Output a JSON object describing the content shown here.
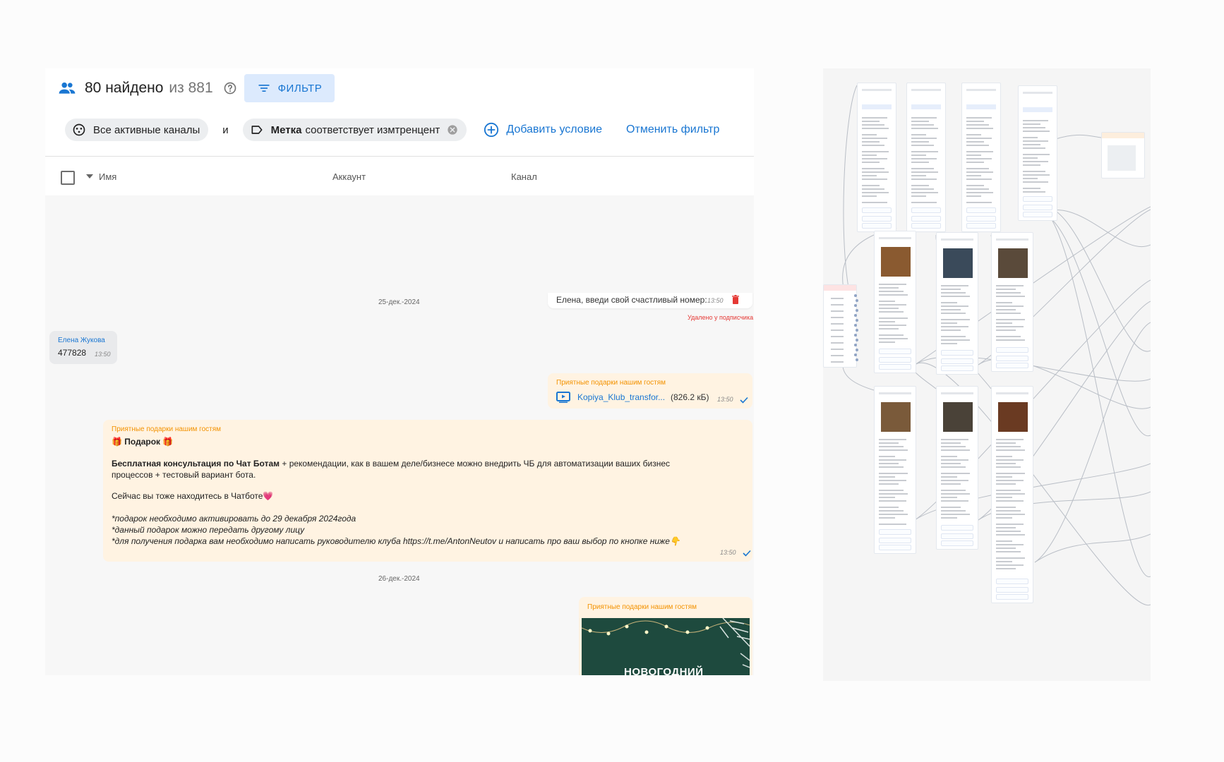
{
  "header": {
    "found": "80 найдено",
    "total": "из 881",
    "filter_button": "ФИЛЬТР"
  },
  "filter": {
    "chip_channels": "Все активные каналы",
    "and": "и",
    "chip_tag_label": "Метка",
    "chip_tag_value": "соответствует измтренцент",
    "add_condition": "Добавить условие",
    "cancel_filter": "Отменить фильтр"
  },
  "table": {
    "col_name": "Имя",
    "col_account": "Аккаунт",
    "col_channel": "Канал"
  },
  "chat": {
    "date1": "25-дек.-2024",
    "date2": "26-дек.-2024",
    "msg1": {
      "text": "Елена, введи свой счастливый номер:",
      "time": "13:50",
      "note": "Удалено у подписчика"
    },
    "msg2": {
      "sender": "Елена Жукова",
      "text": "477828",
      "time": "13:50"
    },
    "msg3": {
      "sender": "Приятные подарки нашим гостям",
      "file_name": "Kopiya_Klub_transfor...",
      "file_size": "(826.2 кБ)",
      "time": "13:50"
    },
    "msg4": {
      "sender": "Приятные подарки нашим гостям",
      "title": "🎁 Подарок 🎁",
      "bold_part": "Бесплатная консультация по Чат Ботам",
      "line1_rest": " + рекомендации, как в вашем деле/бизнесе можно внедрить ЧБ для автоматизации ваших бизнес",
      "line2": "процессов + тестовый вариант бота.",
      "line3": "Сейчас вы тоже находитесь в Чатботе💗",
      "line4": "*подарок необходимо активировать до 29 декабря 2024года",
      "line5": "*данный подарок можно передать другому лицу",
      "line6": "*для получения подарка вам необходимо написать руководителю клуба https://t.me/AntonNeutov и написать про ваш выбор по кнопке ниже👇",
      "time": "13:50"
    },
    "msg5": {
      "sender": "Приятные подарки нашим гостям",
      "image_text": "НОВОГОДНИЙ"
    }
  },
  "icons": {
    "people": "people-icon",
    "help": "help-circle-icon",
    "filter": "filter-list-icon",
    "channels": "channels-icon",
    "tag": "tag-icon",
    "close": "close-circle-icon",
    "add": "add-circle-icon",
    "trash": "trash-icon",
    "video": "video-file-icon",
    "check": "check-icon"
  },
  "colors": {
    "accent": "#1976d2",
    "sender_orange": "#f39200",
    "bubble_orange": "#fff3e2",
    "deleted_red": "#e53935"
  }
}
